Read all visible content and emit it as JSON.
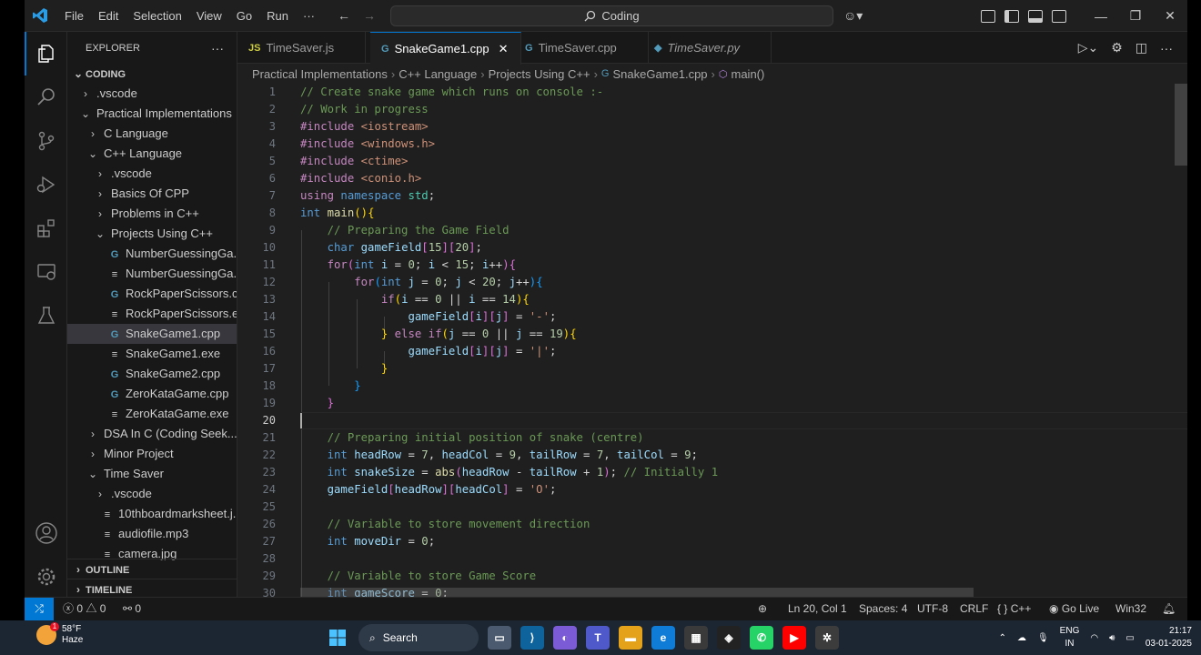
{
  "titlebar": {
    "menu": [
      "File",
      "Edit",
      "Selection",
      "View",
      "Go",
      "Run",
      "···"
    ],
    "search": "Coding"
  },
  "sidebar": {
    "header": "EXPLORER",
    "root": "CODING",
    "items": [
      {
        "label": ".vscode",
        "depth": 1,
        "kind": "folder",
        "open": false
      },
      {
        "label": "Practical Implementations",
        "depth": 1,
        "kind": "folder",
        "open": true
      },
      {
        "label": "C Language",
        "depth": 2,
        "kind": "folder",
        "open": false
      },
      {
        "label": "C++ Language",
        "depth": 2,
        "kind": "folder",
        "open": true
      },
      {
        "label": ".vscode",
        "depth": 3,
        "kind": "folder",
        "open": false
      },
      {
        "label": "Basics Of CPP",
        "depth": 3,
        "kind": "folder",
        "open": false
      },
      {
        "label": "Problems in C++",
        "depth": 3,
        "kind": "folder",
        "open": false
      },
      {
        "label": "Projects Using C++",
        "depth": 3,
        "kind": "folder",
        "open": true
      },
      {
        "label": "NumberGuessingGa...",
        "depth": 4,
        "kind": "cpp"
      },
      {
        "label": "NumberGuessingGa...",
        "depth": 4,
        "kind": "exe"
      },
      {
        "label": "RockPaperScissors.c...",
        "depth": 4,
        "kind": "cpp"
      },
      {
        "label": "RockPaperScissors.exe",
        "depth": 4,
        "kind": "exe"
      },
      {
        "label": "SnakeGame1.cpp",
        "depth": 4,
        "kind": "cpp",
        "selected": true
      },
      {
        "label": "SnakeGame1.exe",
        "depth": 4,
        "kind": "exe"
      },
      {
        "label": "SnakeGame2.cpp",
        "depth": 4,
        "kind": "cpp"
      },
      {
        "label": "ZeroKataGame.cpp",
        "depth": 4,
        "kind": "cpp"
      },
      {
        "label": "ZeroKataGame.exe",
        "depth": 4,
        "kind": "exe"
      },
      {
        "label": "DSA In C (Coding Seek...",
        "depth": 2,
        "kind": "folder",
        "open": false
      },
      {
        "label": "Minor Project",
        "depth": 2,
        "kind": "folder",
        "open": false
      },
      {
        "label": "Time Saver",
        "depth": 2,
        "kind": "folder",
        "open": true
      },
      {
        "label": ".vscode",
        "depth": 3,
        "kind": "folder",
        "open": false
      },
      {
        "label": "10thboardmarksheet.j...",
        "depth": 3,
        "kind": "file"
      },
      {
        "label": "audiofile.mp3",
        "depth": 3,
        "kind": "file"
      },
      {
        "label": "camera.jpg",
        "depth": 3,
        "kind": "file"
      }
    ],
    "outline": "OUTLINE",
    "timeline": "TIMELINE"
  },
  "tabs": [
    {
      "label": "TimeSaver.js",
      "icon": "JS",
      "color": "#cbcb41",
      "active": false
    },
    {
      "label": "SnakeGame1.cpp",
      "icon": "G",
      "color": "#519aba",
      "active": true
    },
    {
      "label": "TimeSaver.cpp",
      "icon": "G",
      "color": "#519aba",
      "active": false
    },
    {
      "label": "TimeSaver.py",
      "icon": "◆",
      "color": "#519aba",
      "active": false
    }
  ],
  "breadcrumb": [
    "Practical Implementations",
    "C++ Language",
    "Projects Using C++",
    "SnakeGame1.cpp",
    "main()"
  ],
  "editor": {
    "current_line": 20,
    "lines": [
      [
        [
          "c-com",
          "// Create snake game which runs on console :-"
        ]
      ],
      [
        [
          "c-com",
          "// Work in progress"
        ]
      ],
      [
        [
          "c-ctl",
          "#include "
        ],
        [
          "c-str",
          "<iostream>"
        ]
      ],
      [
        [
          "c-ctl",
          "#include "
        ],
        [
          "c-str",
          "<windows.h>"
        ]
      ],
      [
        [
          "c-ctl",
          "#include "
        ],
        [
          "c-str",
          "<ctime>"
        ]
      ],
      [
        [
          "c-ctl",
          "#include "
        ],
        [
          "c-str",
          "<conio.h>"
        ]
      ],
      [
        [
          "c-ctl",
          "using "
        ],
        [
          "c-kw",
          "namespace "
        ],
        [
          "c-ty",
          "std"
        ],
        [
          "",
          ";"
        ]
      ],
      [
        [
          "c-kw",
          "int "
        ],
        [
          "c-fn",
          "main"
        ],
        [
          "c-b1",
          "()"
        ],
        [
          "c-b1",
          "{"
        ]
      ],
      [
        [
          "",
          "    "
        ],
        [
          "c-com",
          "// Preparing the Game Field"
        ]
      ],
      [
        [
          "",
          "    "
        ],
        [
          "c-kw",
          "char "
        ],
        [
          "c-var",
          "gameField"
        ],
        [
          "c-b2",
          "["
        ],
        [
          "c-num",
          "15"
        ],
        [
          "c-b2",
          "]"
        ],
        [
          "c-b2",
          "["
        ],
        [
          "c-num",
          "20"
        ],
        [
          "c-b2",
          "]"
        ],
        [
          "",
          ";"
        ]
      ],
      [
        [
          "",
          "    "
        ],
        [
          "c-ctl",
          "for"
        ],
        [
          "c-b2",
          "("
        ],
        [
          "c-kw",
          "int "
        ],
        [
          "c-var",
          "i"
        ],
        [
          "",
          " = "
        ],
        [
          "c-num",
          "0"
        ],
        [
          "",
          "; "
        ],
        [
          "c-var",
          "i"
        ],
        [
          "",
          " < "
        ],
        [
          "c-num",
          "15"
        ],
        [
          "",
          "; "
        ],
        [
          "c-var",
          "i"
        ],
        [
          "",
          "++"
        ],
        [
          "c-b2",
          ")"
        ],
        [
          "c-b2",
          "{"
        ]
      ],
      [
        [
          "",
          "        "
        ],
        [
          "c-ctl",
          "for"
        ],
        [
          "c-b3",
          "("
        ],
        [
          "c-kw",
          "int "
        ],
        [
          "c-var",
          "j"
        ],
        [
          "",
          " = "
        ],
        [
          "c-num",
          "0"
        ],
        [
          "",
          "; "
        ],
        [
          "c-var",
          "j"
        ],
        [
          "",
          " < "
        ],
        [
          "c-num",
          "20"
        ],
        [
          "",
          "; "
        ],
        [
          "c-var",
          "j"
        ],
        [
          "",
          "++"
        ],
        [
          "c-b3",
          ")"
        ],
        [
          "c-b3",
          "{"
        ]
      ],
      [
        [
          "",
          "            "
        ],
        [
          "c-ctl",
          "if"
        ],
        [
          "c-b1",
          "("
        ],
        [
          "c-var",
          "i"
        ],
        [
          "",
          " == "
        ],
        [
          "c-num",
          "0"
        ],
        [
          "",
          " || "
        ],
        [
          "c-var",
          "i"
        ],
        [
          "",
          " == "
        ],
        [
          "c-num",
          "14"
        ],
        [
          "c-b1",
          ")"
        ],
        [
          "c-b1",
          "{"
        ]
      ],
      [
        [
          "",
          "                "
        ],
        [
          "c-var",
          "gameField"
        ],
        [
          "c-b2",
          "["
        ],
        [
          "c-var",
          "i"
        ],
        [
          "c-b2",
          "]"
        ],
        [
          "c-b2",
          "["
        ],
        [
          "c-var",
          "j"
        ],
        [
          "c-b2",
          "]"
        ],
        [
          "",
          " = "
        ],
        [
          "c-str",
          "'-'"
        ],
        [
          "",
          ";"
        ]
      ],
      [
        [
          "",
          "            "
        ],
        [
          "c-b1",
          "}"
        ],
        [
          "",
          " "
        ],
        [
          "c-ctl",
          "else if"
        ],
        [
          "c-b1",
          "("
        ],
        [
          "c-var",
          "j"
        ],
        [
          "",
          " == "
        ],
        [
          "c-num",
          "0"
        ],
        [
          "",
          " || "
        ],
        [
          "c-var",
          "j"
        ],
        [
          "",
          " == "
        ],
        [
          "c-num",
          "19"
        ],
        [
          "c-b1",
          ")"
        ],
        [
          "c-b1",
          "{"
        ]
      ],
      [
        [
          "",
          "                "
        ],
        [
          "c-var",
          "gameField"
        ],
        [
          "c-b2",
          "["
        ],
        [
          "c-var",
          "i"
        ],
        [
          "c-b2",
          "]"
        ],
        [
          "c-b2",
          "["
        ],
        [
          "c-var",
          "j"
        ],
        [
          "c-b2",
          "]"
        ],
        [
          "",
          " = "
        ],
        [
          "c-str",
          "'|'"
        ],
        [
          "",
          ";"
        ]
      ],
      [
        [
          "",
          "            "
        ],
        [
          "c-b1",
          "}"
        ]
      ],
      [
        [
          "",
          "        "
        ],
        [
          "c-b3",
          "}"
        ]
      ],
      [
        [
          "",
          "    "
        ],
        [
          "c-b2",
          "}"
        ]
      ],
      [
        [
          "",
          ""
        ]
      ],
      [
        [
          "",
          "    "
        ],
        [
          "c-com",
          "// Preparing initial position of snake (centre)"
        ]
      ],
      [
        [
          "",
          "    "
        ],
        [
          "c-kw",
          "int "
        ],
        [
          "c-var",
          "headRow"
        ],
        [
          "",
          " = "
        ],
        [
          "c-num",
          "7"
        ],
        [
          "",
          ", "
        ],
        [
          "c-var",
          "headCol"
        ],
        [
          "",
          " = "
        ],
        [
          "c-num",
          "9"
        ],
        [
          "",
          ", "
        ],
        [
          "c-var",
          "tailRow"
        ],
        [
          "",
          " = "
        ],
        [
          "c-num",
          "7"
        ],
        [
          "",
          ", "
        ],
        [
          "c-var",
          "tailCol"
        ],
        [
          "",
          " = "
        ],
        [
          "c-num",
          "9"
        ],
        [
          "",
          ";"
        ]
      ],
      [
        [
          "",
          "    "
        ],
        [
          "c-kw",
          "int "
        ],
        [
          "c-var",
          "snakeSize"
        ],
        [
          "",
          " = "
        ],
        [
          "c-fn",
          "abs"
        ],
        [
          "c-b2",
          "("
        ],
        [
          "c-var",
          "headRow"
        ],
        [
          "",
          " - "
        ],
        [
          "c-var",
          "tailRow"
        ],
        [
          "",
          " + "
        ],
        [
          "c-num",
          "1"
        ],
        [
          "c-b2",
          ")"
        ],
        [
          "",
          "; "
        ],
        [
          "c-com",
          "// Initially 1"
        ]
      ],
      [
        [
          "",
          "    "
        ],
        [
          "c-var",
          "gameField"
        ],
        [
          "c-b2",
          "["
        ],
        [
          "c-var",
          "headRow"
        ],
        [
          "c-b2",
          "]"
        ],
        [
          "c-b2",
          "["
        ],
        [
          "c-var",
          "headCol"
        ],
        [
          "c-b2",
          "]"
        ],
        [
          "",
          " = "
        ],
        [
          "c-str",
          "'O'"
        ],
        [
          "",
          ";"
        ]
      ],
      [
        [
          "",
          ""
        ]
      ],
      [
        [
          "",
          "    "
        ],
        [
          "c-com",
          "// Variable to store movement direction"
        ]
      ],
      [
        [
          "",
          "    "
        ],
        [
          "c-kw",
          "int "
        ],
        [
          "c-var",
          "moveDir"
        ],
        [
          "",
          " = "
        ],
        [
          "c-num",
          "0"
        ],
        [
          "",
          ";"
        ]
      ],
      [
        [
          "",
          ""
        ]
      ],
      [
        [
          "",
          "    "
        ],
        [
          "c-com",
          "// Variable to store Game Score"
        ]
      ],
      [
        [
          "",
          "    "
        ],
        [
          "c-kw",
          "int "
        ],
        [
          "c-var",
          "gameScore"
        ],
        [
          "",
          " = "
        ],
        [
          "c-num",
          "0"
        ],
        [
          "",
          ";"
        ]
      ]
    ]
  },
  "statusbar": {
    "problems": "0",
    "warnings": "0",
    "ports": "0",
    "position": "Ln 20, Col 1",
    "spaces": "Spaces: 4",
    "encoding": "UTF-8",
    "eol": "CRLF",
    "language": "C++",
    "golive": "Go Live",
    "platform": "Win32"
  },
  "taskbar": {
    "temp": "58°F",
    "weather": "Haze",
    "weather_badge": "1",
    "search": "Search",
    "lang1": "ENG",
    "lang2": "IN",
    "time": "21:17",
    "date": "03-01-2025"
  }
}
